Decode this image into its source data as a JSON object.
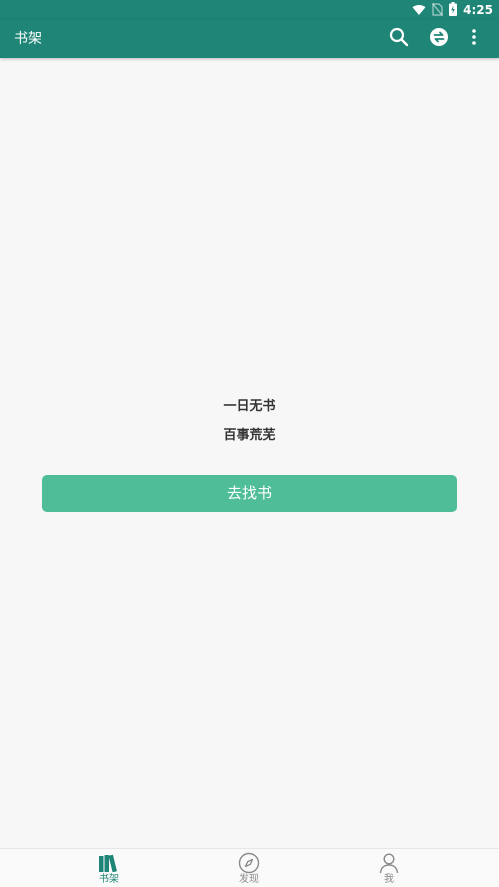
{
  "status_bar": {
    "time": "4:25",
    "icons": [
      "wifi-icon",
      "no-sim-icon",
      "battery-charging-icon"
    ]
  },
  "toolbar": {
    "title": "书架",
    "actions": [
      "search-icon",
      "sync-icon",
      "more-vert-icon"
    ]
  },
  "empty_state": {
    "line1": "一日无书",
    "line2": "百事荒芜",
    "button_label": "去找书"
  },
  "bottom_nav": {
    "items": [
      {
        "label": "书架",
        "icon": "bookshelf-icon",
        "active": true
      },
      {
        "label": "发现",
        "icon": "compass-icon",
        "active": false
      },
      {
        "label": "我",
        "icon": "person-icon",
        "active": false
      }
    ]
  },
  "colors": {
    "primary": "#1f8577",
    "accent_button": "#4fbe98",
    "background": "#f7f7f7",
    "nav_inactive": "#8a8a8a"
  }
}
